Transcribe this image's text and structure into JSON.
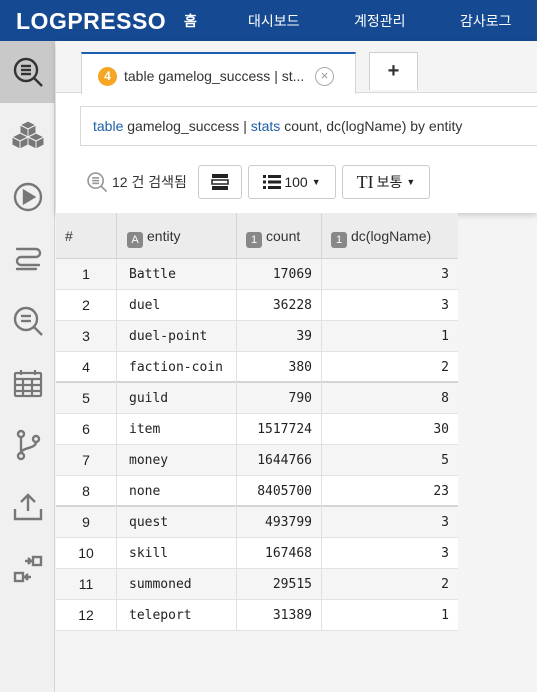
{
  "nav": {
    "logo": "LOGPRESSO",
    "items": [
      {
        "label": "홈",
        "active": true
      },
      {
        "label": "대시보드",
        "active": false
      },
      {
        "label": "계정관리",
        "active": false
      },
      {
        "label": "감사로그",
        "active": false
      }
    ]
  },
  "sidebar": {
    "items": [
      {
        "icon": "query-icon",
        "active": true
      },
      {
        "icon": "cubes-icon",
        "active": false
      },
      {
        "icon": "play-icon",
        "active": false
      },
      {
        "icon": "stream-icon",
        "active": false
      },
      {
        "icon": "search-icon",
        "active": false
      },
      {
        "icon": "calendar-icon",
        "active": false
      },
      {
        "icon": "branch-icon",
        "active": false
      },
      {
        "icon": "upload-icon",
        "active": false
      },
      {
        "icon": "transfer-icon",
        "active": false
      }
    ]
  },
  "tab": {
    "badge": "4",
    "title": "table gamelog_success | st...",
    "add_label": "+"
  },
  "query": {
    "kw1": "table",
    "part1": " gamelog_success | ",
    "kw2": "stats",
    "part2": " count, dc(logName) by entity"
  },
  "toolbar": {
    "result_count": "12 건 검색됨",
    "page_size": "100",
    "font_size": "보통"
  },
  "table": {
    "headers": [
      {
        "label": "#",
        "type": ""
      },
      {
        "label": "entity",
        "type": "A"
      },
      {
        "label": "count",
        "type": "1"
      },
      {
        "label": "dc(logName)",
        "type": "1"
      }
    ],
    "rows": [
      {
        "no": "1",
        "entity": "Battle",
        "count": "17069",
        "dc": "3"
      },
      {
        "no": "2",
        "entity": "duel",
        "count": "36228",
        "dc": "3"
      },
      {
        "no": "3",
        "entity": "duel-point",
        "count": "39",
        "dc": "1"
      },
      {
        "no": "4",
        "entity": "faction-coin",
        "count": "380",
        "dc": "2"
      },
      {
        "no": "5",
        "entity": "guild",
        "count": "790",
        "dc": "8"
      },
      {
        "no": "6",
        "entity": "item",
        "count": "1517724",
        "dc": "30"
      },
      {
        "no": "7",
        "entity": "money",
        "count": "1644766",
        "dc": "5"
      },
      {
        "no": "8",
        "entity": "none",
        "count": "8405700",
        "dc": "23"
      },
      {
        "no": "9",
        "entity": "quest",
        "count": "493799",
        "dc": "3"
      },
      {
        "no": "10",
        "entity": "skill",
        "count": "167468",
        "dc": "3"
      },
      {
        "no": "11",
        "entity": "summoned",
        "count": "29515",
        "dc": "2"
      },
      {
        "no": "12",
        "entity": "teleport",
        "count": "31389",
        "dc": "1"
      }
    ]
  },
  "colors": {
    "nav_bg": "#154a92",
    "accent": "#1f5fa8",
    "tab_badge": "#f5a623"
  }
}
